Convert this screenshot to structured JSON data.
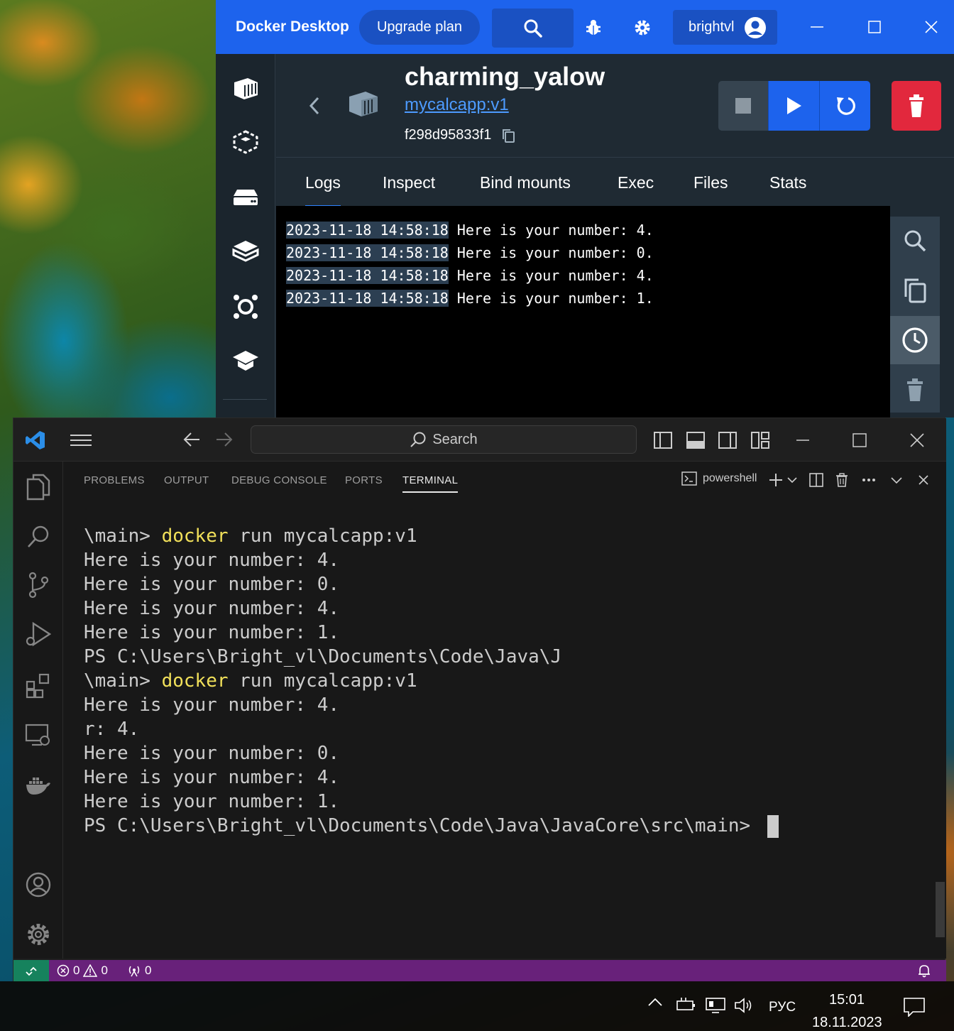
{
  "docker": {
    "app_title": "Docker Desktop",
    "upgrade_label": "Upgrade plan",
    "user_name": "brightvl",
    "accent_color": "#1d63ed",
    "container": {
      "name": "charming_yalow",
      "image": "mycalcapp:v1",
      "id": "f298d95833f1"
    },
    "tabs": [
      "Logs",
      "Inspect",
      "Bind mounts",
      "Exec",
      "Files",
      "Stats"
    ],
    "active_tab": "Logs",
    "logs": [
      {
        "ts": "2023-11-18 14:58:18",
        "msg": " Here is your number: 4."
      },
      {
        "ts": "2023-11-18 14:58:18",
        "msg": " Here is your number: 0."
      },
      {
        "ts": "2023-11-18 14:58:18",
        "msg": " Here is your number: 4."
      },
      {
        "ts": "2023-11-18 14:58:18",
        "msg": " Here is your number: 1."
      }
    ],
    "sidebar_icons": [
      "containers-icon",
      "images-icon",
      "volumes-icon",
      "builds-icon",
      "extensions-icon",
      "learning-icon"
    ]
  },
  "vscode": {
    "search_label": "Search",
    "panel_tabs": [
      "PROBLEMS",
      "OUTPUT",
      "DEBUG CONSOLE",
      "PORTS",
      "TERMINAL"
    ],
    "active_panel_tab": "TERMINAL",
    "shell_label": "powershell",
    "terminal": [
      {
        "pre": "\\main> ",
        "cmd": "docker",
        "post": " run mycalcapp:v1"
      },
      {
        "pre": "Here is your number: 4.",
        "cmd": "",
        "post": ""
      },
      {
        "pre": "Here is your number: 0.",
        "cmd": "",
        "post": ""
      },
      {
        "pre": "Here is your number: 4.",
        "cmd": "",
        "post": ""
      },
      {
        "pre": "Here is your number: 1.",
        "cmd": "",
        "post": ""
      },
      {
        "pre": "PS C:\\Users\\Bright_vl\\Documents\\Code\\Java\\J",
        "cmd": "",
        "post": ""
      },
      {
        "pre": "\\main> ",
        "cmd": "docker",
        "post": " run mycalcapp:v1"
      },
      {
        "pre": "Here is your number: 4.",
        "cmd": "",
        "post": ""
      },
      {
        "pre": "r: 4.",
        "cmd": "",
        "post": ""
      },
      {
        "pre": "Here is your number: 0.",
        "cmd": "",
        "post": ""
      },
      {
        "pre": "Here is your number: 4.",
        "cmd": "",
        "post": ""
      },
      {
        "pre": "Here is your number: 1.",
        "cmd": "",
        "post": ""
      }
    ],
    "prompt": "PS C:\\Users\\Bright_vl\\Documents\\Code\\Java\\JavaCore\\src\\main> ",
    "status": {
      "errors": "0",
      "warnings": "0",
      "ports": "0",
      "bar_color": "#68217a",
      "remote_color": "#16825d"
    }
  },
  "taskbar": {
    "language": "РУС",
    "time": "15:01",
    "date": "18.11.2023"
  }
}
